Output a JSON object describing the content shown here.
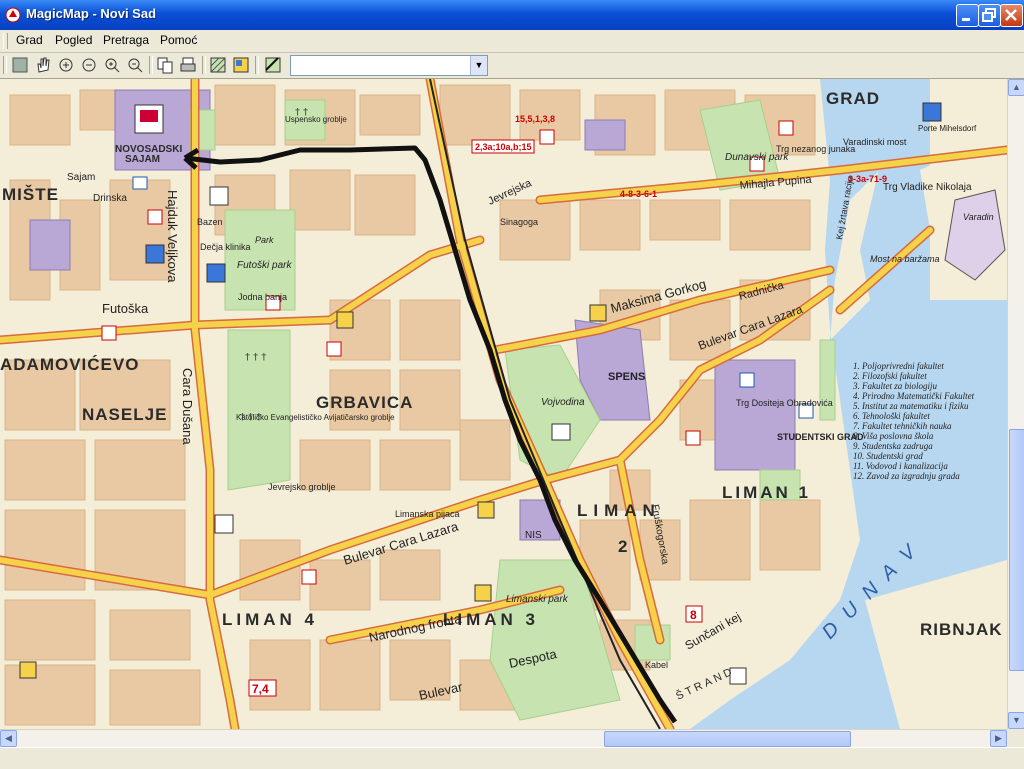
{
  "window": {
    "title": "MagicMap - Novi Sad"
  },
  "menu": {
    "items": [
      "Grad",
      "Pogled",
      "Pretraga",
      "Pomoć"
    ]
  },
  "toolbar": {
    "combo_value": ""
  },
  "map": {
    "districts": [
      "GRAD",
      "MIŠTE",
      "NOVOSADSKI",
      "SAJAM",
      "ADAMOVIĆEVO",
      "NASELJE",
      "GRBAVICA",
      "LIMAN",
      "LIMAN 1",
      "2",
      "LIMAN 4",
      "LIMAN 3",
      "RIBNJAK",
      "D U N A V",
      "ŠTRAND"
    ],
    "streets": [
      "Futoška",
      "Hajduk Veljkova",
      "Bulevar Cara Lazara",
      "Cara Dušana",
      "Narodnog fronta",
      "Maksima Gorkog",
      "Radnička",
      "Kej žrtava racije",
      "Mihajla Pupina",
      "Bulevar",
      "Despota",
      "Sunčani kej",
      "Fruškogorska",
      "Jevrejska",
      "Bulevar Cara Lazara"
    ],
    "places": [
      "SPENS",
      "NIS",
      "Limanski park",
      "Futoški park",
      "Dunavski park",
      "Vojvodina",
      "Katoličko Evangelističko Avijatičarsko groblje",
      "Dečja klinika",
      "Jodna banja",
      "Bazen",
      "Sinagoga",
      "Most na baržama",
      "Varadinski most",
      "Trg Vladike Nikolaja",
      "Trg nezanog junaka",
      "Trg Dositeja Obradovića",
      "STUDENTSKI GRAD",
      "Limanska pijaca",
      "Jevrejsko groblje",
      "Drinska",
      "Kabel",
      "Porte Mihelsdorf",
      "Varadin",
      "Uspensko groblje",
      "Park",
      "Sajam"
    ],
    "bus_lines": [
      "2,3a;10a,b;15",
      "15,5,1,3,8",
      "3-3a-71-9",
      "4-8-3-6-1",
      "7,4",
      "8"
    ],
    "legend": [
      "1.   Poljoprivredni fakultet",
      "2.   Filozofski fakultet",
      "3.   Fakultet za biologiju",
      "4.   Prirodno Matematički Fakultet",
      "5.   Institut za matematiku i fiziku",
      "6.   Tehnološki fakultet",
      "7.   Fakultet tehničkih nauka",
      "8.   Viša poslovna škola",
      "9.   Studentska zadruga",
      "10. Studentski grad",
      "11. Vodovod i kanalizacija",
      "12. Zavod za izgradnju grada"
    ]
  },
  "colors": {
    "water": "#b7d6ef",
    "land": "#f4eed8",
    "block": "#e9c9a3",
    "park": "#c7e3b0",
    "institution": "#b9a7d6",
    "main_road": "#f6d24a",
    "road_edge": "#d76a3e",
    "route": "#111111"
  }
}
